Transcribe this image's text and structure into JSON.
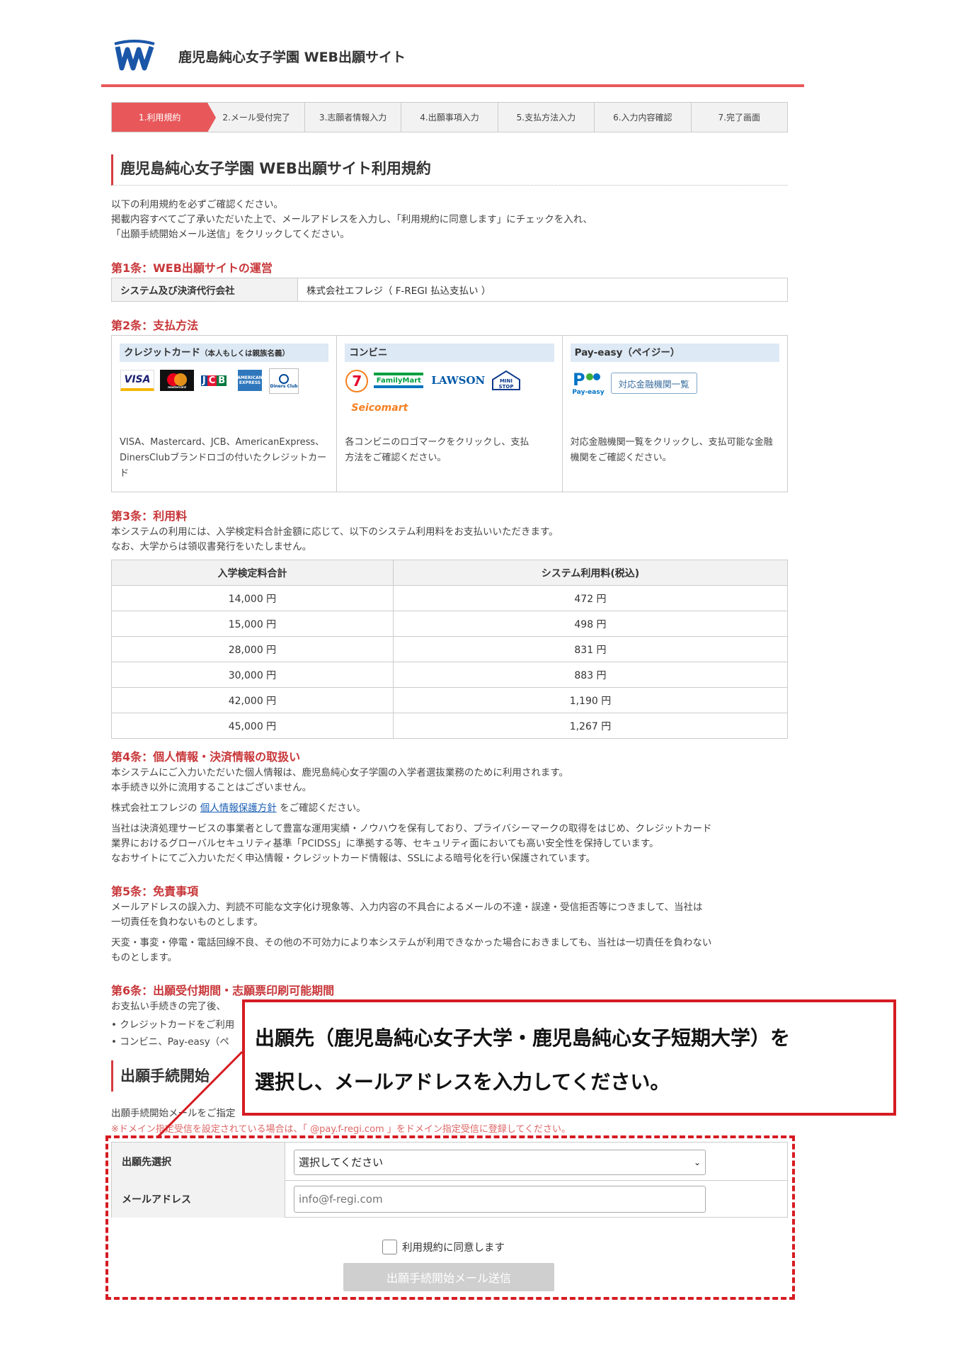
{
  "header": {
    "title": "鹿児島純心女子学園 WEB出願サイト"
  },
  "steps": [
    "1.利用規約",
    "2.メール受付完了",
    "3.志願者情報入力",
    "4.出願事項入力",
    "5.支払方法入力",
    "6.入力内容確認",
    "7.完了画面"
  ],
  "page": {
    "heading": "鹿児島純心女子学園 WEB出願サイト利用規約",
    "intro": [
      "以下の利用規約を必ずご確認ください。",
      "掲載内容すべてご了承いただいた上で、メールアドレスを入力し、「利用規約に同意します」にチェックを入れ、",
      "「出願手続開始メール送信」をクリックしてください。"
    ]
  },
  "art1": {
    "title": "第1条：WEB出願サイトの運営",
    "label": "システム及び決済代行会社",
    "value": "株式会社エフレジ（ F-REGI 払込支払い ）"
  },
  "art2": {
    "title": "第2条：支払方法",
    "credit": {
      "title": "クレジットカード",
      "title_note": "（本人もしくは親族名義）",
      "logos": [
        "VISA",
        "mastercard",
        "JCB",
        "AMERICAN EXPRESS",
        "Diners Club"
      ],
      "desc": "VISA、Mastercard、JCB、AmericanExpress、DinersClubブランドロゴの付いたクレジットカード"
    },
    "conv": {
      "title": "コンビニ",
      "logos": [
        "7",
        "FamilyMart",
        "LAWSON",
        "MINI STOP",
        "Seicomart"
      ],
      "desc": "各コンビニのロゴマークをクリックし、支払方法をご確認ください。"
    },
    "payeasy": {
      "title": "Pay-easy（ペイジー）",
      "logo": "Pay-easy",
      "button": "対応金融機関一覧",
      "desc": "対応金融機関一覧をクリックし、支払可能な金融機関をご確認ください。"
    }
  },
  "art3": {
    "title": "第3条：利用料",
    "text": [
      "本システムの利用には、入学検定料合計金額に応じて、以下のシステム利用料をお支払いいただきます。",
      "なお、大学からは領収書発行をいたしません。"
    ],
    "headers": [
      "入学検定料合計",
      "システム利用料(税込)"
    ],
    "rows": [
      [
        "14,000 円",
        "472 円"
      ],
      [
        "15,000 円",
        "498 円"
      ],
      [
        "28,000 円",
        "831 円"
      ],
      [
        "30,000 円",
        "883 円"
      ],
      [
        "42,000 円",
        "1,190 円"
      ],
      [
        "45,000 円",
        "1,267 円"
      ]
    ]
  },
  "art4": {
    "title": "第4条：個人情報・決済情報の取扱い",
    "p1": [
      "本システムにご入力いただいた個人情報は、鹿児島純心女子学園の入学者選抜業務のために利用されます。",
      "本手続き以外に流用することはございません。"
    ],
    "p2_before": "株式会社エフレジの",
    "p2_link": "個人情報保護方針",
    "p2_after": "をご確認ください。",
    "p3": [
      "当社は決済処理サービスの事業者として豊富な運用実績・ノウハウを保有しており、プライバシーマークの取得をはじめ、クレジットカード",
      "業界におけるグローバルセキュリティ基準「PCIDSS」に準拠する等、セキュリティ面においても高い安全性を保持しています。",
      "なおサイトにてご入力いただく申込情報・クレジットカード情報は、SSLによる暗号化を行い保護されています。"
    ]
  },
  "art5": {
    "title": "第5条：免責事項",
    "p1": [
      "メールアドレスの誤入力、判読不可能な文字化け現象等、入力内容の不具合によるメールの不達・誤達・受信拒否等につきまして、当社は",
      "一切責任を負わないものとします。"
    ],
    "p2": [
      "天変・事変・停電・電話回線不良、その他の不可効力により本システムが利用できなかった場合におきましても、当社は一切責任を負わない",
      "ものとします。"
    ]
  },
  "art6": {
    "title": "第6条：出願受付期間・志願票印刷可能期間",
    "text": "お支払い手続きの完了後、",
    "bullets": [
      "クレジットカードをご利用",
      "コンビニ、Pay-easy（ペ"
    ]
  },
  "form": {
    "heading": "出願手続開始",
    "note1": "出願手続開始メールをご指定",
    "note2": "※ドメイン指定受信を設定されている場合は、「 @pay.f-regi.com 」をドメイン指定受信に登録してください。",
    "dest_label": "出願先選択",
    "dest_value": "選択してください",
    "email_label": "メールアドレス",
    "email_placeholder": "info@f-regi.com",
    "agree_label": "利用規約に同意します",
    "submit_label": "出願手続開始メール送信"
  },
  "callout": {
    "line1": "出願先（鹿児島純心女子大学・鹿児島純心女子短期大学）を",
    "line2": "選択し、メールアドレスを入力してください。"
  },
  "colors": {
    "accent": "#e8585a",
    "heading_red": "#c8373a",
    "callout_red": "#d61b22",
    "panel_title_bg": "#dde9f5"
  }
}
